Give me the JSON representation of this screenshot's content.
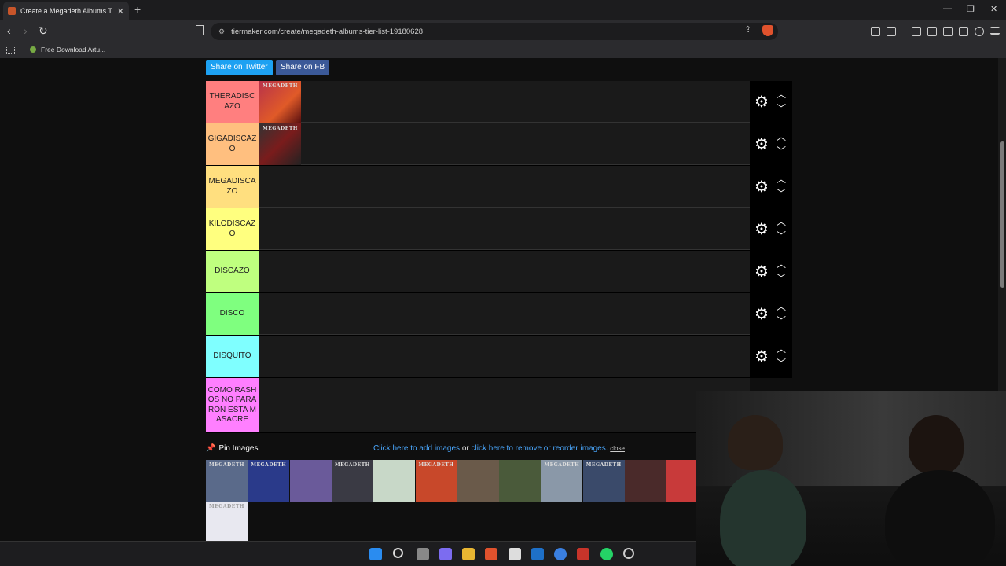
{
  "browser": {
    "tab_title": "Create a Megadeth Albums Tier",
    "url": "tiermaker.com/create/megadeth-albums-tier-list-19180628",
    "bookmark_label": "Free Download Artu..."
  },
  "share": {
    "twitter_label": "Share on Twitter",
    "fb_label": "Share on FB"
  },
  "tiers": [
    {
      "label": "THERADISCAZO",
      "color": "#ff7f7f",
      "albums": [
        "MEGADETH"
      ]
    },
    {
      "label": "GIGADISCAZO",
      "color": "#ffbf7f",
      "albums": [
        "MEGADETH"
      ]
    },
    {
      "label": "MEGADISCAZO",
      "color": "#ffdf7f",
      "albums": []
    },
    {
      "label": "KILODISCAZO",
      "color": "#ffff7f",
      "albums": []
    },
    {
      "label": "DISCAZO",
      "color": "#bfff7f",
      "albums": []
    },
    {
      "label": "DISCO",
      "color": "#7fff7f",
      "albums": []
    },
    {
      "label": "DISQUITO",
      "color": "#7fffff",
      "albums": []
    },
    {
      "label": "COMO RASHOS NO PARARON ESTA MASACRE",
      "color": "#ff7fff",
      "albums": []
    }
  ],
  "pin": {
    "label": "Pin Images",
    "add_link": "Click here to add images",
    "or_text": "or",
    "reorder_link": "click here to remove or reorder images.",
    "close_label": "close"
  },
  "pool_albums": [
    "MEGADETH",
    "MEGADETH",
    "",
    "MEGADETH",
    "",
    "MEGADETH",
    "",
    "",
    "MEGADETH",
    "MEGADETH",
    "",
    "",
    "MEGADETH"
  ]
}
